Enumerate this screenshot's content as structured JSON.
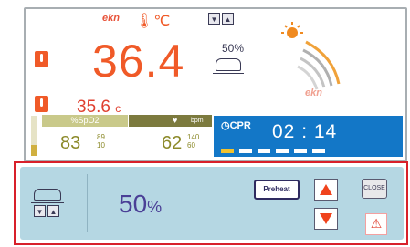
{
  "top": {
    "logo": "ekn",
    "temp_label": "℃",
    "temp_value": "36.4",
    "humidity_pct": "50%",
    "skin_temp_value": "35.6",
    "skin_temp_unit": "c",
    "heater_logo": "ekn",
    "heater_icon": "heater-arc-icon"
  },
  "vitals": {
    "spo2_label": "%SpO2",
    "spo2_value": "83",
    "spo2_limits": [
      "89",
      "10"
    ],
    "pulse_label": "bpm",
    "pulse_value": "62",
    "pulse_limits": [
      "140",
      "60"
    ],
    "cpr_label": "CPR",
    "cpr_time": "02 : 14",
    "cpr_progress_segments": 6,
    "cpr_progress_filled": 1
  },
  "panel": {
    "humidity_value": "50",
    "humidity_unit": "%",
    "preheat_label": "Preheat",
    "close_label": "CLOSE"
  },
  "colors": {
    "temperature": "#f05a28",
    "vitals_olive": "#8c8a2a",
    "cpr_blue": "#1377c7",
    "panel_bg": "#b5d7e3",
    "highlight_frame": "#d8202a",
    "humidity_text": "#4a3f96"
  }
}
